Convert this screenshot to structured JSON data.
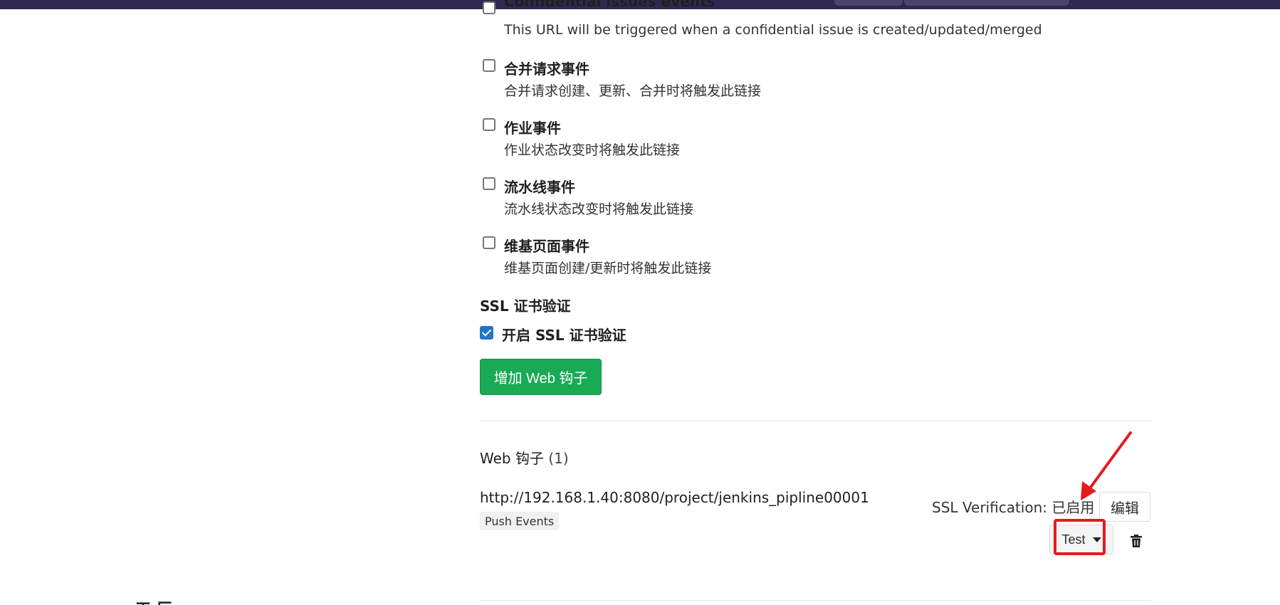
{
  "events": [
    {
      "title": "Confidential issues events",
      "desc": "This URL will be triggered when a confidential issue is created/updated/merged"
    },
    {
      "title": "合并请求事件",
      "desc": "合并请求创建、更新、合并时将触发此链接"
    },
    {
      "title": "作业事件",
      "desc": "作业状态改变时将触发此链接"
    },
    {
      "title": "流水线事件",
      "desc": "流水线状态改变时将触发此链接"
    },
    {
      "title": "维基页面事件",
      "desc": "维基页面创建/更新时将触发此链接"
    }
  ],
  "ssl": {
    "heading": "SSL 证书验证",
    "checkbox_label": "开启 SSL 证书验证",
    "checked": true
  },
  "add_button": "增加 Web 钩子",
  "hooks": {
    "title": "Web 钩子",
    "count": "(1)",
    "items": [
      {
        "url": "http://192.168.1.40:8080/project/jenkins_pipline00001",
        "tag": "Push Events",
        "ssl_verification": "SSL Verification: 已启用",
        "edit_label": "编辑",
        "test_label": "Test"
      }
    ]
  },
  "footer_fragment": "工 厂",
  "colors": {
    "topbar": "#2e2a4f",
    "primary_green": "#1aaa55",
    "checkbox_blue": "#1f75cb",
    "annotation_red": "#e8191c"
  },
  "icons": [
    "trash-icon",
    "caret-down-icon",
    "check-icon"
  ]
}
